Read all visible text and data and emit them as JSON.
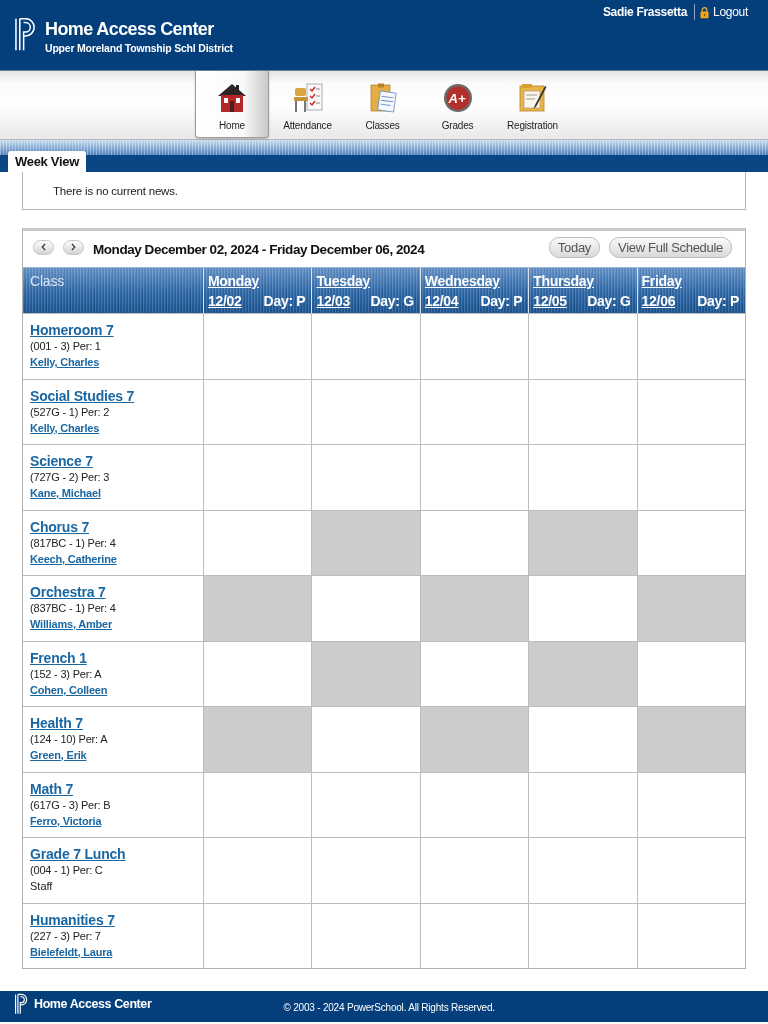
{
  "header": {
    "title": "Home Access Center",
    "subtitle": "Upper Moreland Township Schl District",
    "user": "Sadie Frassetta",
    "logout": "Logout"
  },
  "nav": [
    {
      "kind": "home",
      "label": "Home",
      "selected": true
    },
    {
      "kind": "attendance",
      "label": "Attendance",
      "selected": false
    },
    {
      "kind": "classes",
      "label": "Classes",
      "selected": false
    },
    {
      "kind": "grades",
      "label": "Grades",
      "selected": false,
      "icon_text": "A+"
    },
    {
      "kind": "registration",
      "label": "Registration",
      "selected": false
    }
  ],
  "tabs": [
    {
      "label": "Week View",
      "selected": true
    }
  ],
  "news": {
    "message": "There is no current news."
  },
  "week": {
    "range": "Monday December 02, 2024 - Friday December 06, 2024",
    "buttons": [
      "Today",
      "View Full Schedule"
    ]
  },
  "table": {
    "class_heading": "Class",
    "days": [
      {
        "name": "Monday",
        "date": "12/02",
        "day": "Day: P"
      },
      {
        "name": "Tuesday",
        "date": "12/03",
        "day": "Day: G"
      },
      {
        "name": "Wednesday",
        "date": "12/04",
        "day": "Day: P"
      },
      {
        "name": "Thursday",
        "date": "12/05",
        "day": "Day: G"
      },
      {
        "name": "Friday",
        "date": "12/06",
        "day": "Day: P"
      }
    ],
    "rows": [
      {
        "course": "Homeroom 7",
        "section": "(001 - 3) Per: 1",
        "teacher": "Kelly, Charles",
        "teacher_linked": true,
        "cells": [
          {
            "shaded": false
          },
          {
            "shaded": false
          },
          {
            "shaded": false
          },
          {
            "shaded": false
          },
          {
            "shaded": false
          }
        ]
      },
      {
        "course": "Social Studies 7",
        "section": "(527G - 1) Per: 2",
        "teacher": "Kelly, Charles",
        "teacher_linked": true,
        "cells": [
          {
            "shaded": false
          },
          {
            "shaded": false
          },
          {
            "shaded": false
          },
          {
            "shaded": false
          },
          {
            "shaded": false
          }
        ]
      },
      {
        "course": "Science 7",
        "section": "(727G - 2) Per: 3",
        "teacher": "Kane, Michael",
        "teacher_linked": true,
        "cells": [
          {
            "shaded": false
          },
          {
            "shaded": false
          },
          {
            "shaded": false
          },
          {
            "shaded": false
          },
          {
            "shaded": false
          }
        ]
      },
      {
        "course": "Chorus 7",
        "section": "(817BC - 1) Per: 4",
        "teacher": "Keech, Catherine",
        "teacher_linked": true,
        "cells": [
          {
            "shaded": false
          },
          {
            "shaded": true
          },
          {
            "shaded": false
          },
          {
            "shaded": true
          },
          {
            "shaded": false
          }
        ]
      },
      {
        "course": "Orchestra 7",
        "section": "(837BC - 1) Per: 4",
        "teacher": "Williams, Amber",
        "teacher_linked": true,
        "cells": [
          {
            "shaded": true
          },
          {
            "shaded": false
          },
          {
            "shaded": true
          },
          {
            "shaded": false
          },
          {
            "shaded": true
          }
        ]
      },
      {
        "course": "French 1",
        "section": "(152 - 3) Per: A",
        "teacher": "Cohen, Colleen",
        "teacher_linked": true,
        "cells": [
          {
            "shaded": false
          },
          {
            "shaded": true
          },
          {
            "shaded": false
          },
          {
            "shaded": true
          },
          {
            "shaded": false
          }
        ]
      },
      {
        "course": "Health 7",
        "section": "(124 - 10) Per: A",
        "teacher": "Green, Erik",
        "teacher_linked": true,
        "cells": [
          {
            "shaded": true
          },
          {
            "shaded": false
          },
          {
            "shaded": true
          },
          {
            "shaded": false
          },
          {
            "shaded": true
          }
        ]
      },
      {
        "course": "Math 7",
        "section": "(617G - 3) Per: B",
        "teacher": "Ferro, Victoria",
        "teacher_linked": true,
        "cells": [
          {
            "shaded": false
          },
          {
            "shaded": false
          },
          {
            "shaded": false
          },
          {
            "shaded": false
          },
          {
            "shaded": false
          }
        ]
      },
      {
        "course": "Grade 7 Lunch",
        "section": "(004 - 1) Per: C",
        "teacher": "Staff",
        "teacher_linked": false,
        "cells": [
          {
            "shaded": false
          },
          {
            "shaded": false
          },
          {
            "shaded": false
          },
          {
            "shaded": false
          },
          {
            "shaded": false
          }
        ]
      },
      {
        "course": "Humanities 7",
        "section": "(227 - 3) Per: 7",
        "teacher": "Bielefeldt, Laura",
        "teacher_linked": true,
        "cells": [
          {
            "shaded": false
          },
          {
            "shaded": false
          },
          {
            "shaded": false
          },
          {
            "shaded": false
          },
          {
            "shaded": false
          }
        ]
      }
    ]
  },
  "footer": {
    "brand": "Home Access Center",
    "copyright": "© 2003 - 2024 PowerSchool. All Rights Reserved."
  }
}
